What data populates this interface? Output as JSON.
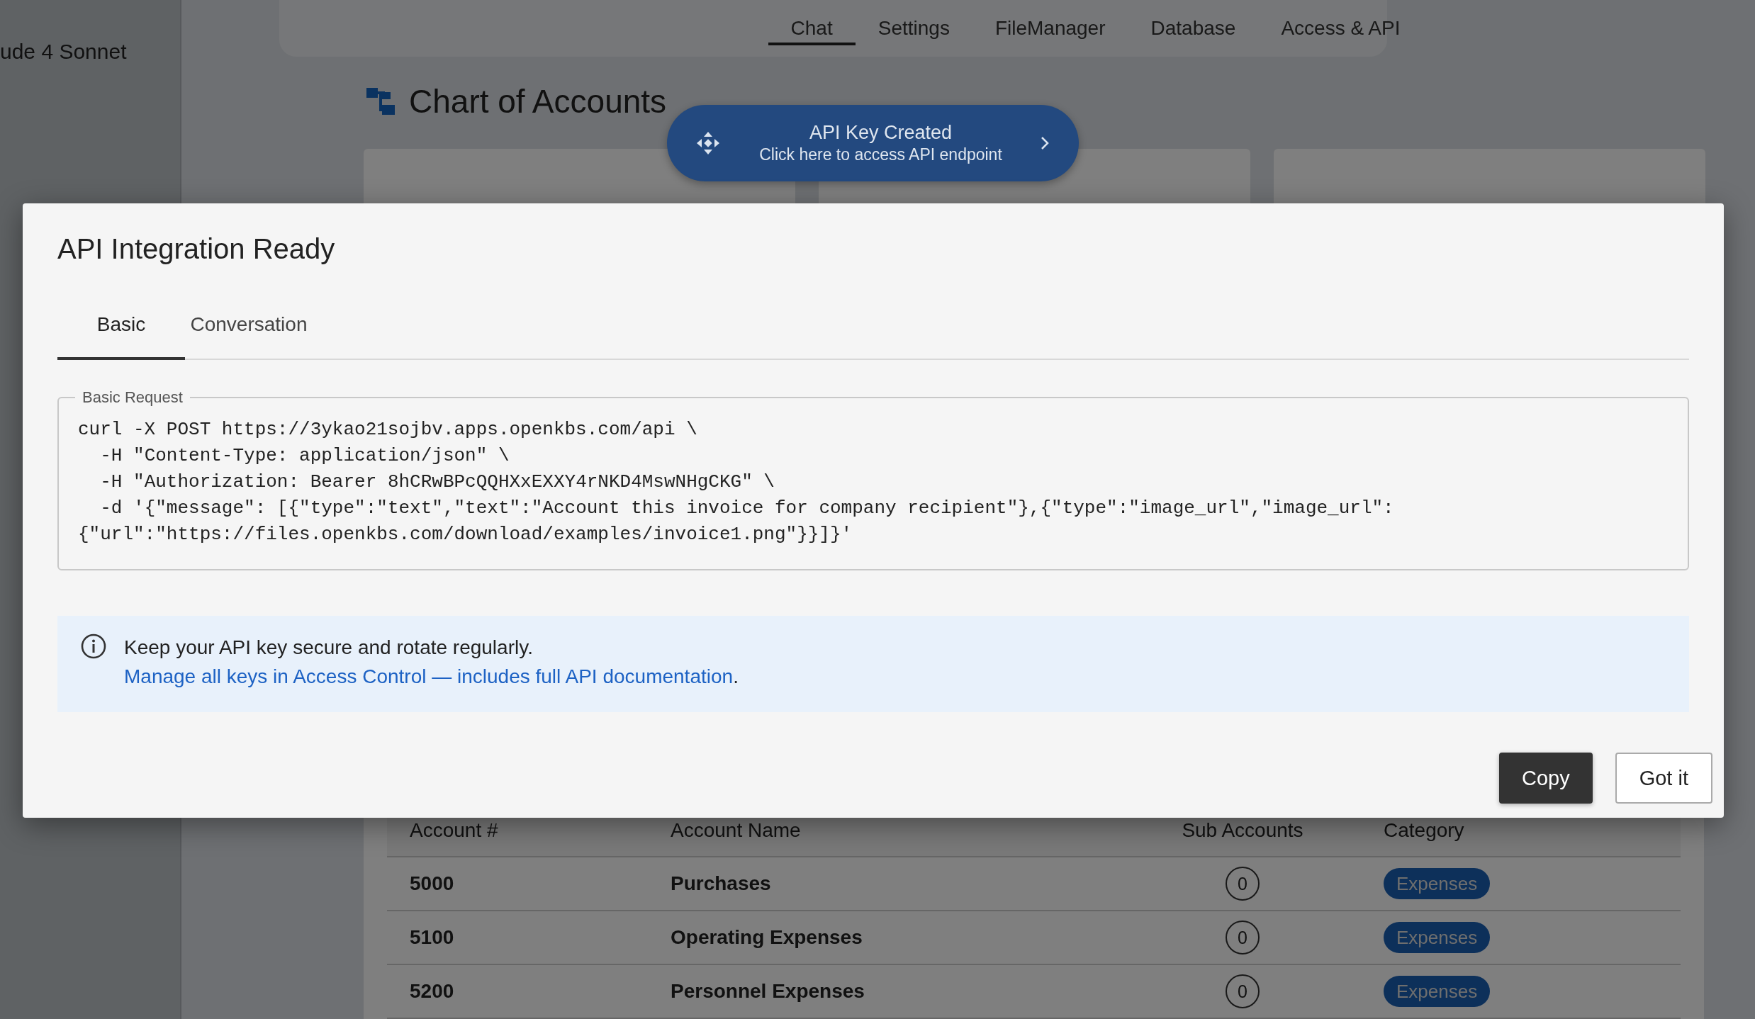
{
  "model_selector": {
    "label": "ude 4 Sonnet"
  },
  "nav_tabs": [
    {
      "label": "Chat",
      "selected": true
    },
    {
      "label": "Settings",
      "selected": false
    },
    {
      "label": "FileManager",
      "selected": false
    },
    {
      "label": "Database",
      "selected": false
    },
    {
      "label": "Access & API",
      "selected": false
    }
  ],
  "page_title": "Chart of Accounts",
  "toast": {
    "title": "API Key Created",
    "subtitle": "Click here to access API endpoint"
  },
  "table": {
    "columns": [
      "Account #",
      "Account Name",
      "Sub Accounts",
      "Category"
    ],
    "rows": [
      {
        "number": "5000",
        "name": "Purchases",
        "sub_accounts": "0",
        "category": "Expenses"
      },
      {
        "number": "5100",
        "name": "Operating Expenses",
        "sub_accounts": "0",
        "category": "Expenses"
      },
      {
        "number": "5200",
        "name": "Personnel Expenses",
        "sub_accounts": "0",
        "category": "Expenses"
      }
    ]
  },
  "dialog": {
    "title": "API Integration Ready",
    "tabs": [
      {
        "label": "Basic",
        "selected": true
      },
      {
        "label": "Conversation",
        "selected": false
      }
    ],
    "request_legend": "Basic Request",
    "code_lines": [
      "curl -X POST https://3ykao21sojbv.apps.openkbs.com/api \\",
      "  -H \"Content-Type: application/json\" \\",
      "  -H \"Authorization: Bearer 8hCRwBPcQQHXxEXXY4rNKD4MswNHgCKG\" \\",
      "  -d '{\"message\": [{\"type\":\"text\",\"text\":\"Account this invoice for company recipient\"},{\"type\":\"image_url\",\"image_url\": {\"url\":\"https://files.openkbs.com/download/examples/invoice1.png\"}}]}'"
    ],
    "info": {
      "message": "Keep your API key secure and rotate regularly.",
      "link": "Manage all keys in Access Control — includes full API documentation",
      "after_link": "."
    },
    "buttons": [
      {
        "label": "Copy",
        "kind": "primary"
      },
      {
        "label": "Got it",
        "kind": "outlined"
      }
    ]
  }
}
